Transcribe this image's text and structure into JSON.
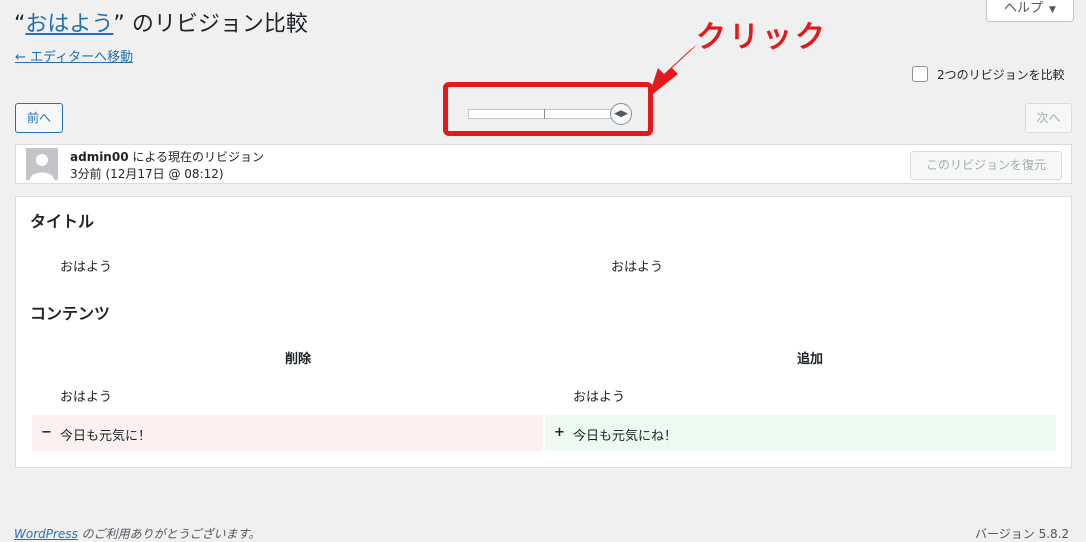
{
  "header": {
    "title_open_quote": "“",
    "title_post": "おはよう",
    "title_rest": "” のリビジョン比較",
    "back_link": "← エディターへ移動",
    "help_label": "ヘルプ"
  },
  "compare_two_label": "2つのリビジョンを比較",
  "nav": {
    "prev_label": "前へ",
    "next_label": "次へ"
  },
  "annotation": {
    "label": "クリック",
    "color": "#e5181b"
  },
  "revision_meta": {
    "author_name": "admin00",
    "author_suffix": " による現在のリビジョン",
    "date": "3分前 (12月17日 @ 08:12)",
    "restore_label": "このリビジョンを復元"
  },
  "diff": {
    "title_heading": "タイトル",
    "title_left": "おはよう",
    "title_right": "おはよう",
    "content_heading": "コンテンツ",
    "col_deleted": "削除",
    "col_added": "追加",
    "context_left": "おはよう",
    "context_right": "おはよう",
    "deleted_sign": "−",
    "deleted_line": "今日も元気に！",
    "added_sign": "+",
    "added_line": "今日も元気にね！"
  },
  "footer": {
    "wp_link": "WordPress",
    "thanks": " のご利用ありがとうございます。",
    "version": "バージョン 5.8.2"
  },
  "colors": {
    "link": "#2271b1",
    "deleted_bg": "#fcf0f1",
    "added_bg": "#edfaef"
  }
}
